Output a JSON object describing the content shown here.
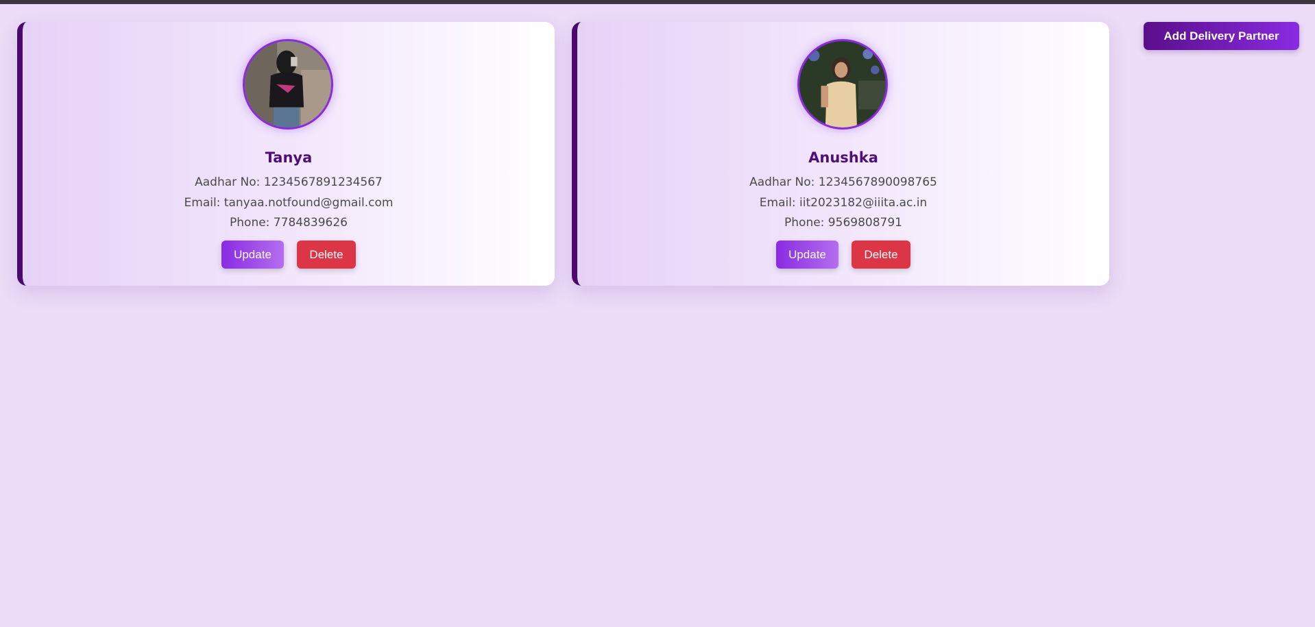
{
  "header": {
    "add_button_label": "Add Delivery Partner"
  },
  "partners": [
    {
      "name": "Tanya",
      "aadhar": "Aadhar No: 1234567891234567",
      "email": "Email: tanyaa.notfound@gmail.com",
      "phone": "Phone: 7784839626",
      "update_label": "Update",
      "delete_label": "Delete"
    },
    {
      "name": "Anushka",
      "aadhar": "Aadhar No: 1234567890098765",
      "email": "Email: iit2023182@iiita.ac.in",
      "phone": "Phone: 9569808791",
      "update_label": "Update",
      "delete_label": "Delete"
    }
  ],
  "colors": {
    "background": "#ecdcf7",
    "accent": "#8a2be2",
    "card_border": "#4b0a6b",
    "name_text": "#4e0f79",
    "delete": "#dc3545"
  }
}
